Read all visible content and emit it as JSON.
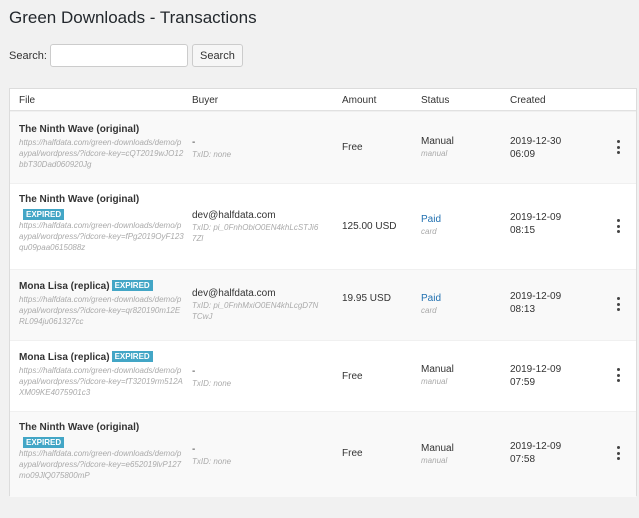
{
  "page": {
    "title": "Green Downloads - Transactions"
  },
  "search": {
    "label": "Search:",
    "placeholder": "",
    "value": "",
    "button_label": "Search"
  },
  "columns": {
    "file": "File",
    "buyer": "Buyer",
    "amount": "Amount",
    "status": "Status",
    "created": "Created"
  },
  "badge_label": "EXPIRED",
  "colors": {
    "badge": "#43a6c6",
    "paid": "#2271b1",
    "row_alt": "#f9f9f9"
  },
  "rows": [
    {
      "file_title": "The Ninth Wave (original)",
      "expired": false,
      "file_url": "https://halfdata.com/green-downloads/demo/paypal/wordpress/?idcore-key=cQT2019wJO12bbT30Dad060920Jg",
      "buyer": "-",
      "txid": "TxID: none",
      "amount": "Free",
      "status": "Manual",
      "status_sub": "manual",
      "created_date": "2019-12-30",
      "created_time": "06:09"
    },
    {
      "file_title": "The Ninth Wave (original)",
      "expired": true,
      "file_url": "https://halfdata.com/green-downloads/demo/paypal/wordpress/?idcore-key=fPg2019OyF123qu09paa0615088z",
      "buyer": "dev@halfdata.com",
      "txid": "TxID: pi_0FnhObiO0EN4khLcSTJi67Zl",
      "amount": "125.00 USD",
      "status": "Paid",
      "status_sub": "card",
      "created_date": "2019-12-09",
      "created_time": "08:15"
    },
    {
      "file_title": "Mona Lisa (replica)",
      "expired": true,
      "file_url": "https://halfdata.com/green-downloads/demo/paypal/wordpress/?idcore-key=qr820190m12ERL094ju061327cc",
      "buyer": "dev@halfdata.com",
      "txid": "TxID: pi_0FnhMxiO0EN4khLcgD7NTCwJ",
      "amount": "19.95 USD",
      "status": "Paid",
      "status_sub": "card",
      "created_date": "2019-12-09",
      "created_time": "08:13"
    },
    {
      "file_title": "Mona Lisa (replica)",
      "expired": true,
      "file_url": "https://halfdata.com/green-downloads/demo/paypal/wordpress/?idcore-key=fT32019rm512AXM09KE4075901c3",
      "buyer": "-",
      "txid": "TxID: none",
      "amount": "Free",
      "status": "Manual",
      "status_sub": "manual",
      "created_date": "2019-12-09",
      "created_time": "07:59"
    },
    {
      "file_title": "The Ninth Wave (original)",
      "expired": true,
      "file_url": "https://halfdata.com/green-downloads/demo/paypal/wordpress/?idcore-key=e652019lvP127mo09JlQ075800mP",
      "buyer": "-",
      "txid": "TxID: none",
      "amount": "Free",
      "status": "Manual",
      "status_sub": "manual",
      "created_date": "2019-12-09",
      "created_time": "07:58"
    }
  ]
}
